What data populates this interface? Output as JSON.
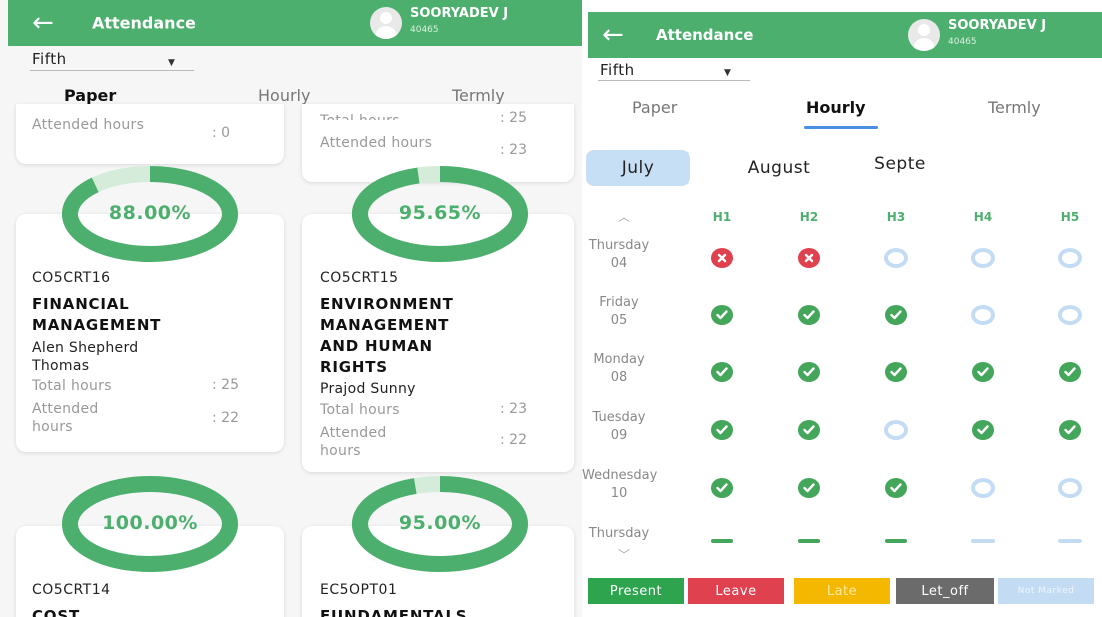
{
  "app": {
    "title": "Attendance",
    "user_name": "SOORYADEV J",
    "user_id": "40465"
  },
  "semester": "Fifth",
  "tabs": [
    "Paper",
    "Hourly",
    "Termly"
  ],
  "left": {
    "active_tab": "Paper",
    "partial_top": [
      {
        "attended_label": "Attended hours",
        "attended_value": ": 0"
      },
      {
        "total_label": "Total hours",
        "total_value": ": 25",
        "attended_label": "Attended hours",
        "attended_value": ": 23"
      }
    ],
    "papers": [
      {
        "percent_text": "88.00%",
        "percent": 88.0,
        "code": "CO5CRT16",
        "subject": [
          "FINANCIAL",
          "MANAGEMENT"
        ],
        "teacher": [
          "Alen Shepherd",
          "Thomas"
        ],
        "total_label": "Total hours",
        "total_value": ": 25",
        "attended_label": "Attended hours",
        "attended_value": ": 22"
      },
      {
        "percent_text": "95.65%",
        "percent": 95.65,
        "code": "CO5CRT15",
        "subject": [
          "ENVIRONMENT",
          "MANAGEMENT",
          "AND HUMAN",
          "RIGHTS"
        ],
        "teacher": [
          "Prajod Sunny"
        ],
        "total_label": "Total hours",
        "total_value": ": 23",
        "attended_label": "Attended hours",
        "attended_value": ": 22"
      },
      {
        "percent_text": "100.00%",
        "percent": 100.0,
        "code": "CO5CRT14",
        "subject": [
          "COST"
        ]
      },
      {
        "percent_text": "95.00%",
        "percent": 95.0,
        "code": "EC5OPT01",
        "subject": [
          "FUNDAMENTALS"
        ]
      }
    ]
  },
  "right": {
    "active_tab": "Hourly",
    "months": [
      "July",
      "August",
      "Septe"
    ],
    "active_month": "July",
    "hours": [
      "H1",
      "H2",
      "H3",
      "H4",
      "H5"
    ],
    "days": [
      {
        "name": "Thursday",
        "date": "04",
        "marks": [
          "leave",
          "leave",
          "none",
          "none",
          "none"
        ]
      },
      {
        "name": "Friday",
        "date": "05",
        "marks": [
          "present",
          "present",
          "present",
          "none",
          "none"
        ]
      },
      {
        "name": "Monday",
        "date": "08",
        "marks": [
          "present",
          "present",
          "present",
          "present",
          "present"
        ]
      },
      {
        "name": "Tuesday",
        "date": "09",
        "marks": [
          "present",
          "present",
          "none",
          "present",
          "present"
        ]
      },
      {
        "name": "Wednesday",
        "date": "10",
        "marks": [
          "present",
          "present",
          "present",
          "none",
          "none"
        ]
      },
      {
        "name": "Thursday",
        "date": "",
        "marks": [
          "present",
          "present",
          "present",
          "none",
          "none"
        ]
      }
    ],
    "legend": [
      {
        "label": "Present",
        "color": "#2ea44f"
      },
      {
        "label": "Leave",
        "color": "#e0414f"
      },
      {
        "label": "Late",
        "color": "#f5b800"
      },
      {
        "label": "Let_off",
        "color": "#6b6b6b"
      },
      {
        "label": "Not Marked",
        "color": "#c4dcf3"
      }
    ]
  },
  "colors": {
    "primary": "#4caf6e",
    "tab_indicator": "#4a90e2",
    "gauge_track": "#d4ecd9"
  }
}
